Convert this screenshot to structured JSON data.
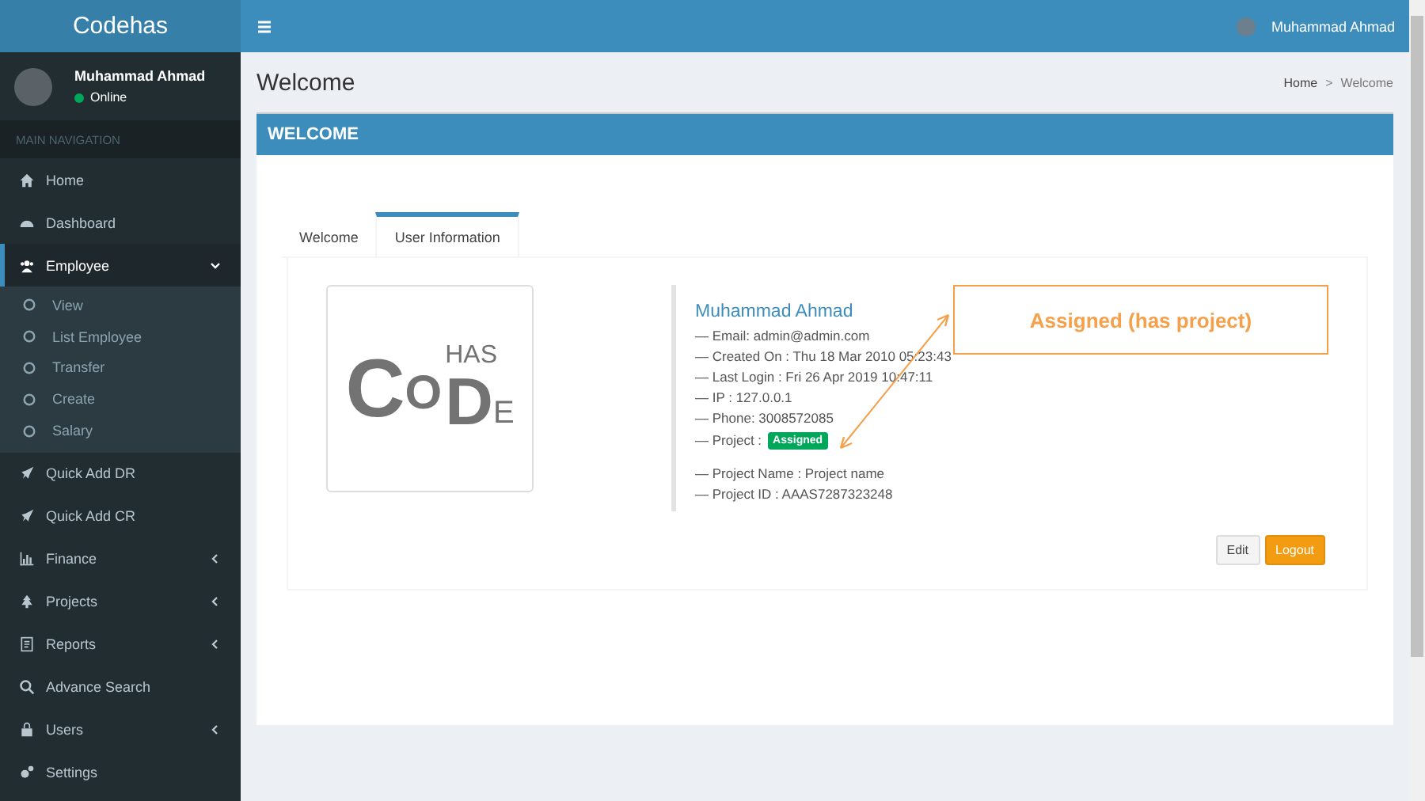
{
  "brand": "Codehas",
  "topbar": {
    "user": "Muhammad Ahmad"
  },
  "sidebar": {
    "user": {
      "name": "Muhammad Ahmad",
      "status": "Online",
      "online": true
    },
    "nav_header": "MAIN NAVIGATION",
    "items": [
      {
        "label": "Home",
        "selected": false,
        "expandable": false
      },
      {
        "label": "Dashboard",
        "selected": false,
        "expandable": false
      },
      {
        "label": "Employee",
        "selected": true,
        "expandable": true,
        "expanded": true,
        "children": [
          {
            "label": "View"
          },
          {
            "label": "List Employee"
          },
          {
            "label": "Transfer"
          },
          {
            "label": "Create"
          },
          {
            "label": "Salary"
          }
        ]
      },
      {
        "label": "Quick Add DR",
        "selected": false,
        "expandable": false
      },
      {
        "label": "Quick Add CR",
        "selected": false,
        "expandable": false
      },
      {
        "label": "Finance",
        "selected": false,
        "expandable": true,
        "expanded": false
      },
      {
        "label": "Projects",
        "selected": false,
        "expandable": true,
        "expanded": false
      },
      {
        "label": "Reports",
        "selected": false,
        "expandable": true,
        "expanded": false
      },
      {
        "label": "Advance Search",
        "selected": false,
        "expandable": false
      },
      {
        "label": "Users",
        "selected": false,
        "expandable": true,
        "expanded": false
      },
      {
        "label": "Settings",
        "selected": false,
        "expandable": false
      }
    ]
  },
  "page": {
    "title": "Welcome",
    "breadcrumb": [
      "Home",
      "Welcome"
    ],
    "breadcrumb_separator": ">"
  },
  "box": {
    "title": "WELCOME",
    "tabs": [
      {
        "label": "Welcome",
        "selected": false
      },
      {
        "label": "User Information",
        "selected": true
      }
    ],
    "logo": {
      "letters": [
        "C",
        "O",
        "HAS",
        "D",
        "E"
      ]
    },
    "profile": {
      "name": "Muhammad Ahmad",
      "lines": [
        "— Email: admin@admin.com",
        "— Created On : Thu 18 Mar 2010 05:23:43",
        "— Last Login : Fri 26 Apr 2019 10:47:11",
        "— IP : 127.0.0.1",
        "— Phone: 3008572085"
      ],
      "project_label": "— Project :",
      "project_badge": "Assigned",
      "project_lines": [
        "— Project Name : Project name",
        "— Project ID : AAAS7287323248"
      ]
    },
    "annotation": "Assigned (has project)",
    "buttons": [
      {
        "label": "Edit",
        "kind": "default"
      },
      {
        "label": "Logout",
        "kind": "warning"
      }
    ]
  }
}
